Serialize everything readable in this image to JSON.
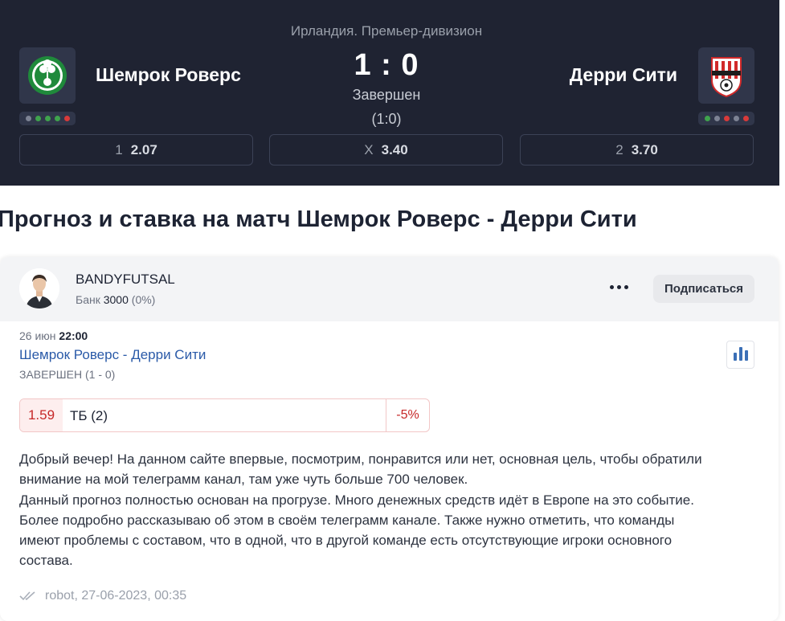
{
  "match": {
    "league": "Ирландия. Премьер-дивизион",
    "home": {
      "name": "Шемрок Роверс",
      "logo_icon": "shamrock-rovers-crest",
      "form": [
        "#7d8394",
        "#3fa34d",
        "#3fa34d",
        "#3fa34d",
        "#d83a3a"
      ]
    },
    "away": {
      "name": "Дерри Сити",
      "logo_icon": "derry-city-crest",
      "form": [
        "#3fa34d",
        "#7d8394",
        "#d83a3a",
        "#7d8394",
        "#d83a3a"
      ]
    },
    "score": "1 : 0",
    "status": "Завершен",
    "halftime": "(1:0)",
    "odds": [
      {
        "label": "1",
        "value": "2.07"
      },
      {
        "label": "X",
        "value": "3.40"
      },
      {
        "label": "2",
        "value": "3.70"
      }
    ]
  },
  "title": "Прогноз и ставка на матч Шемрок Роверс - Дерри Сити",
  "prediction": {
    "author": "BANDYFUTSAL",
    "bank_label": "Банк",
    "bank_value": "3000",
    "bank_percent": "(0%)",
    "subscribe_label": "Подписаться",
    "more_icon": "more-horizontal-icon",
    "date": "26 июн",
    "time": "22:00",
    "match_title": "Шемрок Роверс - Дерри Сити",
    "match_status": "ЗАВЕРШЕН (1 - 0)",
    "stats_icon": "bar-chart-icon",
    "bet": {
      "coef": "1.59",
      "label": "ТБ (2)",
      "result": "-5%"
    },
    "text_lines": [
      "Добрый вечер! На данном сайте впервые, посмотрим, понравится или нет, основная цель, чтобы обратили",
      "внимание на мой телеграмм канал, там уже чуть больше 700 человек.",
      "Данный прогноз полностью основан на прогрузе. Много денежных средств идёт в Европе на это событие.",
      "Более подробно рассказываю об этом в своём телеграмм канале. Также нужно отметить, что команды",
      "имеют проблемы с составом, что в одной, что в другой команде есть отсутствующие игроки основного",
      "состава."
    ],
    "footer_icon": "double-check-icon",
    "footer": "robot, 27-06-2023, 00:35"
  },
  "colors": {
    "header_bg": "#1f2332",
    "link": "#2a5aa8",
    "loss": "#c62828"
  }
}
